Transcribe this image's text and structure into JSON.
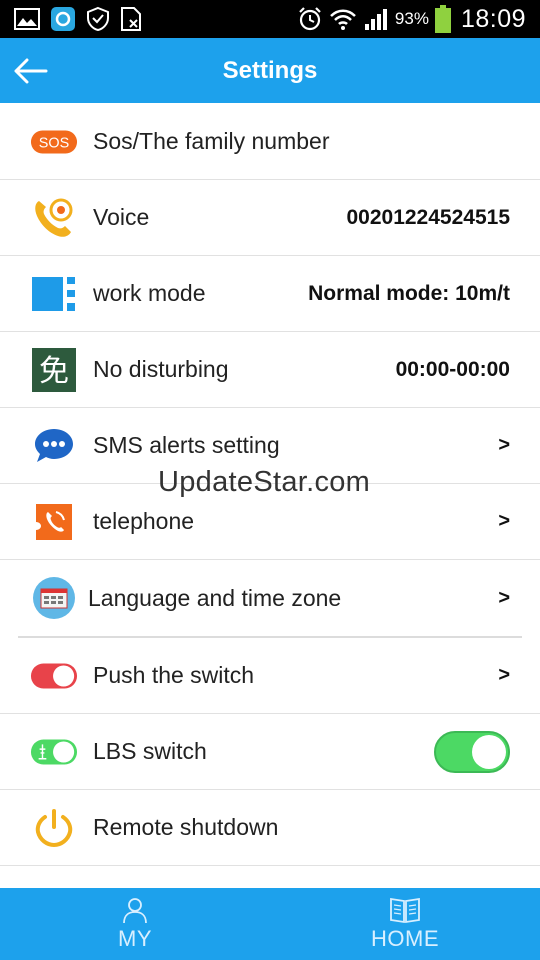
{
  "status_bar": {
    "battery_percent": "93%",
    "time": "18:09"
  },
  "header": {
    "title": "Settings"
  },
  "rows": [
    {
      "label": "Sos/The family number",
      "icon": "sos-icon",
      "sos_badge": "SOS"
    },
    {
      "label": "Voice",
      "value": "00201224524515",
      "icon": "voice-phone-icon"
    },
    {
      "label": "work mode",
      "value": "Normal mode: 10m/t",
      "icon": "work-mode-icon"
    },
    {
      "label": "No disturbing",
      "value": "00:00-00:00",
      "icon": "no-disturb-icon",
      "glyph": "免"
    },
    {
      "label": "SMS alerts setting",
      "arrow": ">",
      "icon": "sms-icon"
    },
    {
      "label": "telephone",
      "arrow": ">",
      "icon": "telephone-icon"
    },
    {
      "label": "Language and time zone",
      "arrow": ">",
      "icon": "language-icon"
    },
    {
      "label": "Push the switch",
      "arrow": ">",
      "icon": "push-switch-icon"
    },
    {
      "label": "LBS switch",
      "toggle_on": true,
      "icon": "lbs-icon"
    },
    {
      "label": "Remote shutdown",
      "icon": "power-icon"
    }
  ],
  "watermark": "UpdateStar.com",
  "bottom_nav": [
    {
      "label": "MY",
      "icon": "person-icon"
    },
    {
      "label": "HOME",
      "icon": "book-icon"
    }
  ],
  "colors": {
    "primary": "#1da1ec",
    "sos_orange": "#f26a1b",
    "toggle_green": "#4cd964",
    "toggle_red": "#e8434a",
    "power_yellow": "#f2b01e"
  }
}
